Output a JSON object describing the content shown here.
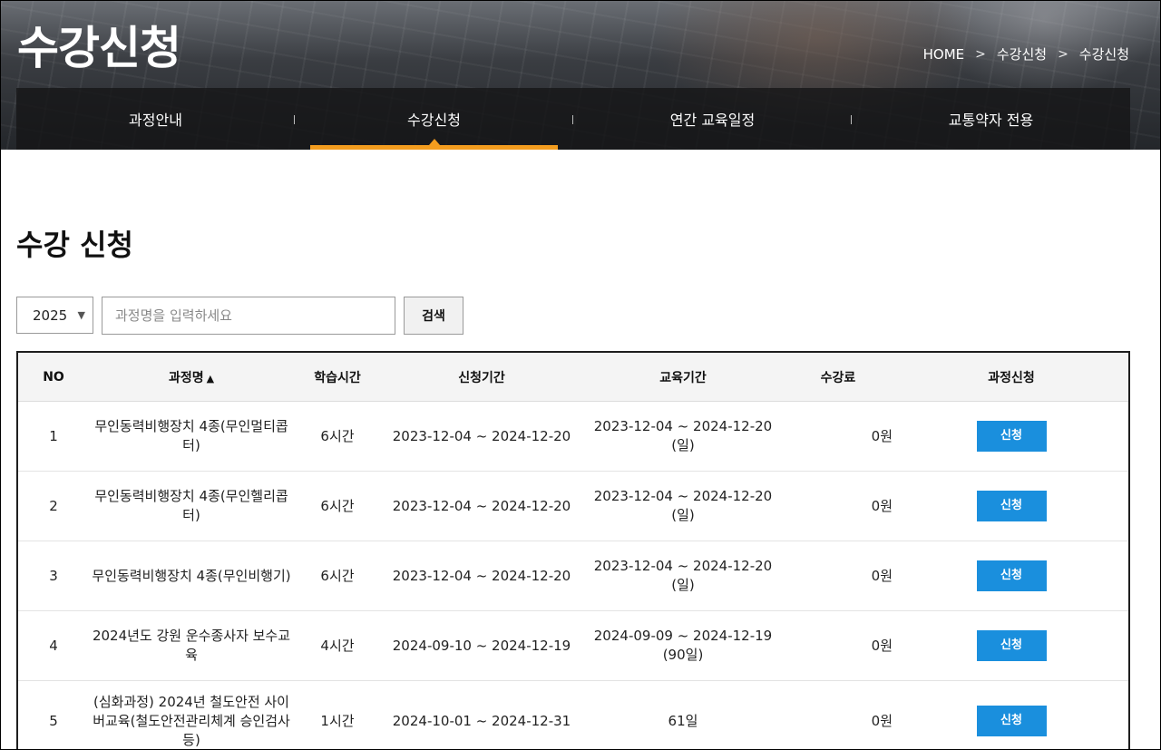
{
  "hero": {
    "title": "수강신청",
    "breadcrumb": [
      "HOME",
      "수강신청",
      "수강신청"
    ]
  },
  "nav": {
    "items": [
      {
        "label": "과정안내",
        "active": false
      },
      {
        "label": "수강신청",
        "active": true
      },
      {
        "label": "연간 교육일정",
        "active": false
      },
      {
        "label": "교통약자 전용",
        "active": false
      }
    ]
  },
  "page": {
    "title": "수강 신청"
  },
  "search": {
    "year": "2025",
    "query": "",
    "placeholder": "과정명을 입력하세요",
    "button_label": "검색"
  },
  "table": {
    "headers": [
      "NO",
      "과정명",
      "학습시간",
      "신청기간",
      "교육기간",
      "수강료",
      "과정신청"
    ],
    "sort_indicator": "▲",
    "rows": [
      {
        "no": "1",
        "name": "무인동력비행장치 4종(무인멀티콥터)",
        "hours": "6시간",
        "apply_period": "2023-12-04 ~ 2024-12-20",
        "edu_period": "2023-12-04 ~ 2024-12-20 (일)",
        "fee": "0원",
        "action": "신청"
      },
      {
        "no": "2",
        "name": "무인동력비행장치 4종(무인헬리콥터)",
        "hours": "6시간",
        "apply_period": "2023-12-04 ~ 2024-12-20",
        "edu_period": "2023-12-04 ~ 2024-12-20 (일)",
        "fee": "0원",
        "action": "신청"
      },
      {
        "no": "3",
        "name": "무인동력비행장치 4종(무인비행기)",
        "hours": "6시간",
        "apply_period": "2023-12-04 ~ 2024-12-20",
        "edu_period": "2023-12-04 ~ 2024-12-20 (일)",
        "fee": "0원",
        "action": "신청"
      },
      {
        "no": "4",
        "name": "2024년도 강원 운수종사자 보수교육",
        "hours": "4시간",
        "apply_period": "2024-09-10 ~ 2024-12-19",
        "edu_period": "2024-09-09 ~ 2024-12-19 (90일)",
        "fee": "0원",
        "action": "신청"
      },
      {
        "no": "5",
        "name": "(심화과정) 2024년 철도안전 사이버교육(철도안전관리체계 승인검사 등)",
        "hours": "1시간",
        "apply_period": "2024-10-01 ~ 2024-12-31",
        "edu_period": "61일",
        "fee": "0원",
        "action": "신청"
      }
    ]
  },
  "colors": {
    "accent": "#f39c1e",
    "button": "#1a8fdd"
  }
}
